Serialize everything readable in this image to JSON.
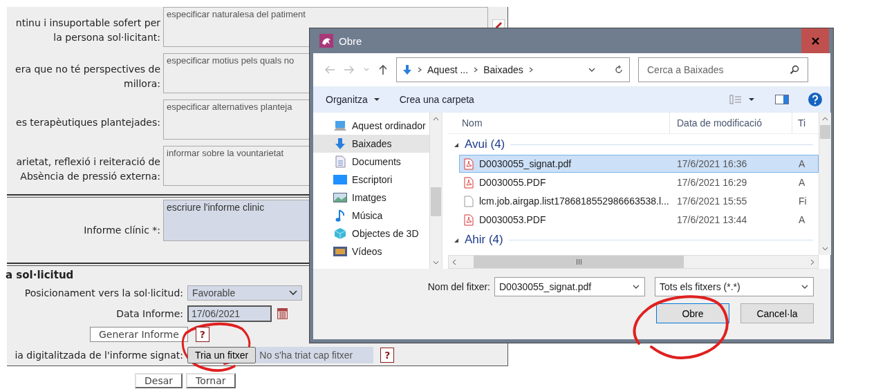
{
  "form": {
    "rows": [
      {
        "label": "ntinu i insuportable sofert per la persona sol·licitant:",
        "placeholder": "especificar naturalesa del patiment"
      },
      {
        "label": "era que no té perspectives de millora:",
        "placeholder": "especificar motius pels quals no"
      },
      {
        "label": "es terapèutiques plantejades:",
        "placeholder": "especificar alternatives planteja"
      },
      {
        "label": "arietat, reflexió i reiteració de Absència de pressió externa:",
        "placeholder": "informar sobre la vountarietat"
      }
    ],
    "clinical_report": {
      "label": "Informe clínic *:",
      "placeholder": "escriure l'informe clinic"
    },
    "section_title": "a sol·licitud",
    "position": {
      "label": "Posicionament vers la sol·licitud:",
      "value": "Favorable"
    },
    "report_date": {
      "label": "Data Informe:",
      "value": "17/06/2021"
    },
    "generate": {
      "button": "Generar Informe",
      "help": "?"
    },
    "signed_copy": {
      "label": "ia digitalitzada de l'informe signat:",
      "button": "Tria un fitxer",
      "status": "No s'ha triat cap fitxer",
      "help": "?"
    },
    "buttons": [
      "Desar",
      "Tornar"
    ]
  },
  "dialog": {
    "title": "Obre",
    "breadcrumb": [
      "Aquest ...",
      "Baixades"
    ],
    "search": {
      "placeholder": "Cerca a Baixades"
    },
    "toolbar": {
      "organize": "Organitza",
      "new_folder": "Crea una carpeta"
    },
    "nav": [
      {
        "label": "Aquest ordinador",
        "kind": "computer",
        "selected": false
      },
      {
        "label": "Baixades",
        "kind": "downloads",
        "selected": true
      },
      {
        "label": "Documents",
        "kind": "documents",
        "selected": false
      },
      {
        "label": "Escriptori",
        "kind": "desktop",
        "selected": false
      },
      {
        "label": "Imatges",
        "kind": "pictures",
        "selected": false
      },
      {
        "label": "Música",
        "kind": "music",
        "selected": false
      },
      {
        "label": "Objectes de 3D",
        "kind": "objects3d",
        "selected": false
      },
      {
        "label": "Vídeos",
        "kind": "videos",
        "selected": false
      }
    ],
    "columns": [
      "Nom",
      "Data de modificació",
      "Ti"
    ],
    "groups": [
      {
        "label": "Avui (4)",
        "expanded": true,
        "files": [
          {
            "name": "D0030055_signat.pdf",
            "date": "17/6/2021 16:36",
            "type": "A",
            "kind": "pdf",
            "selected": true
          },
          {
            "name": "D0030055.PDF",
            "date": "17/6/2021 16:29",
            "type": "A",
            "kind": "pdf",
            "selected": false
          },
          {
            "name": "lcm.job.airgap.list1786818552986663538.l...",
            "date": "17/6/2021 15:55",
            "type": "Fi",
            "kind": "file",
            "selected": false
          },
          {
            "name": "D0030053.PDF",
            "date": "17/6/2021 13:44",
            "type": "A",
            "kind": "pdf",
            "selected": false
          }
        ]
      },
      {
        "label": "Ahir (4)",
        "expanded": true
      }
    ],
    "file_name": {
      "label": "Nom del fitxer:",
      "value": "D0030055_signat.pdf"
    },
    "file_type": "Tots els fitxers (*.*)",
    "buttons": [
      {
        "label": "Obre",
        "default": true
      },
      {
        "label": "Cancel·la",
        "default": false
      }
    ]
  }
}
